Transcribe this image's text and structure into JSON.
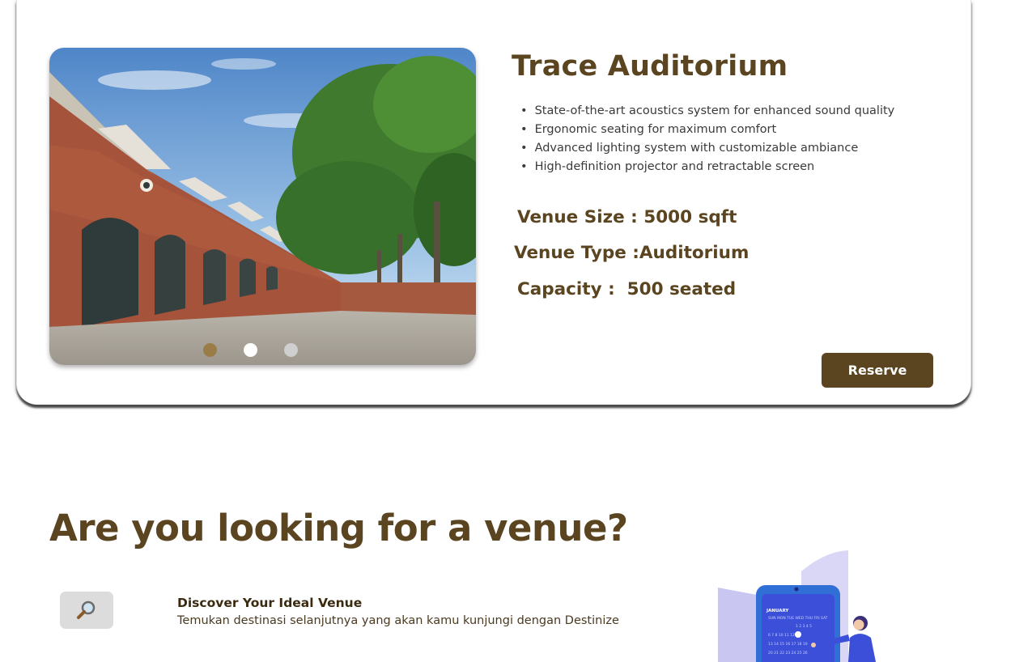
{
  "venue": {
    "title": "Trace Auditorium",
    "features": [
      "State-of-the-art acoustics system for enhanced sound quality",
      "Ergonomic seating for maximum comfort",
      "Advanced lighting system with customizable ambiance",
      "High-definition projector and retractable screen"
    ],
    "size": "Venue Size : 5000 sqft",
    "type": "Venue Type :Auditorium",
    "capacity": "Capacity :  500 seated",
    "reserve_label": "Reserve",
    "carousel": {
      "slides": 3,
      "active_index": 0
    }
  },
  "section": {
    "title": "Are you looking for a venue?",
    "feature_title": "Discover Your Ideal Venue",
    "feature_desc": "Temukan destinasi selanjutnya yang akan kamu kunjungi dengan Destinize",
    "icon": "search-icon",
    "calendar_month": "JANUARY"
  },
  "colors": {
    "brand_brown": "#5b4520",
    "dot_active": "#9a7d46",
    "calendar_blue": "#3b4fd8"
  }
}
